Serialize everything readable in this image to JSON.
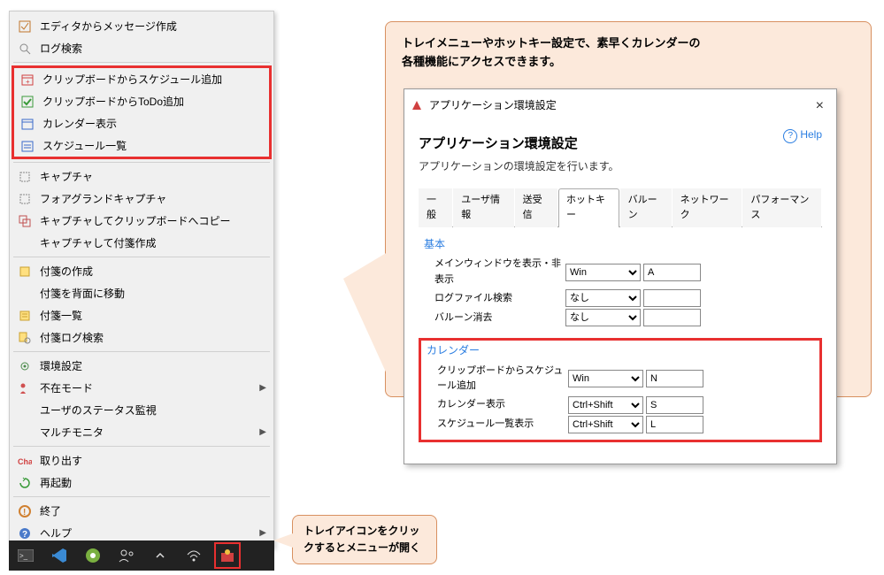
{
  "menu": {
    "items_top": [
      {
        "icon": "edit-icon",
        "label": "エディタからメッセージ作成"
      },
      {
        "icon": "search-icon",
        "label": "ログ検索"
      }
    ],
    "items_cal": [
      {
        "icon": "calendar-add-icon",
        "label": "クリップボードからスケジュール追加"
      },
      {
        "icon": "todo-add-icon",
        "label": "クリップボードからToDo追加"
      },
      {
        "icon": "calendar-icon",
        "label": "カレンダー表示"
      },
      {
        "icon": "schedule-list-icon",
        "label": "スケジュール一覧"
      }
    ],
    "items_capture": [
      {
        "icon": "capture-icon",
        "label": "キャプチャ"
      },
      {
        "icon": "fg-capture-icon",
        "label": "フォアグランドキャプチャ"
      },
      {
        "icon": "capture-copy-icon",
        "label": "キャプチャしてクリップボードへコピー"
      },
      {
        "icon": "capture-note-icon",
        "label": "キャプチャして付箋作成"
      }
    ],
    "items_fusen": [
      {
        "icon": "note-icon",
        "label": "付箋の作成"
      },
      {
        "icon": "",
        "label": "付箋を背面に移動"
      },
      {
        "icon": "note-list-icon",
        "label": "付箋一覧"
      },
      {
        "icon": "note-log-icon",
        "label": "付箋ログ検索"
      }
    ],
    "items_settings": [
      {
        "icon": "gear-icon",
        "label": "環境設定"
      },
      {
        "icon": "away-icon",
        "label": "不在モード",
        "arrow": true
      },
      {
        "icon": "",
        "label": "ユーザのステータス監視"
      },
      {
        "icon": "",
        "label": "マルチモニタ",
        "arrow": true
      }
    ],
    "items_power": [
      {
        "icon": "takeout-icon",
        "label": "取り出す"
      },
      {
        "icon": "restart-icon",
        "label": "再起動"
      }
    ],
    "items_end": [
      {
        "icon": "exit-icon",
        "label": "終了"
      },
      {
        "icon": "help-icon",
        "label": "ヘルプ",
        "arrow": true
      }
    ]
  },
  "callout_top": {
    "line1": "トレイメニューやホットキー設定で、素早くカレンダーの",
    "line2": "各種機能にアクセスできます。"
  },
  "callout_bottom": {
    "line1": "トレイアイコンをクリッ",
    "line2": "クするとメニューが開く"
  },
  "dialog": {
    "window_title": "アプリケーション環境設定",
    "heading": "アプリケーション環境設定",
    "description": "アプリケーションの環境設定を行います。",
    "help": "Help",
    "tabs": [
      "一般",
      "ユーザ情報",
      "送受信",
      "ホットキー",
      "バルーン",
      "ネットワーク",
      "パフォーマンス"
    ],
    "active_tab": "ホットキー",
    "sections": {
      "basic": {
        "title": "基本",
        "rows": [
          {
            "label": "メインウィンドウを表示・非表示",
            "modifier": "Win",
            "key": "A"
          },
          {
            "label": "ログファイル検索",
            "modifier": "なし",
            "key": ""
          },
          {
            "label": "バルーン消去",
            "modifier": "なし",
            "key": ""
          }
        ]
      },
      "calendar": {
        "title": "カレンダー",
        "rows": [
          {
            "label": "クリップボードからスケジュール追加",
            "modifier": "Win",
            "key": "N"
          },
          {
            "label": "カレンダー表示",
            "modifier": "Ctrl+Shift",
            "key": "S"
          },
          {
            "label": "スケジュール一覧表示",
            "modifier": "Ctrl+Shift",
            "key": "L"
          }
        ]
      }
    }
  }
}
